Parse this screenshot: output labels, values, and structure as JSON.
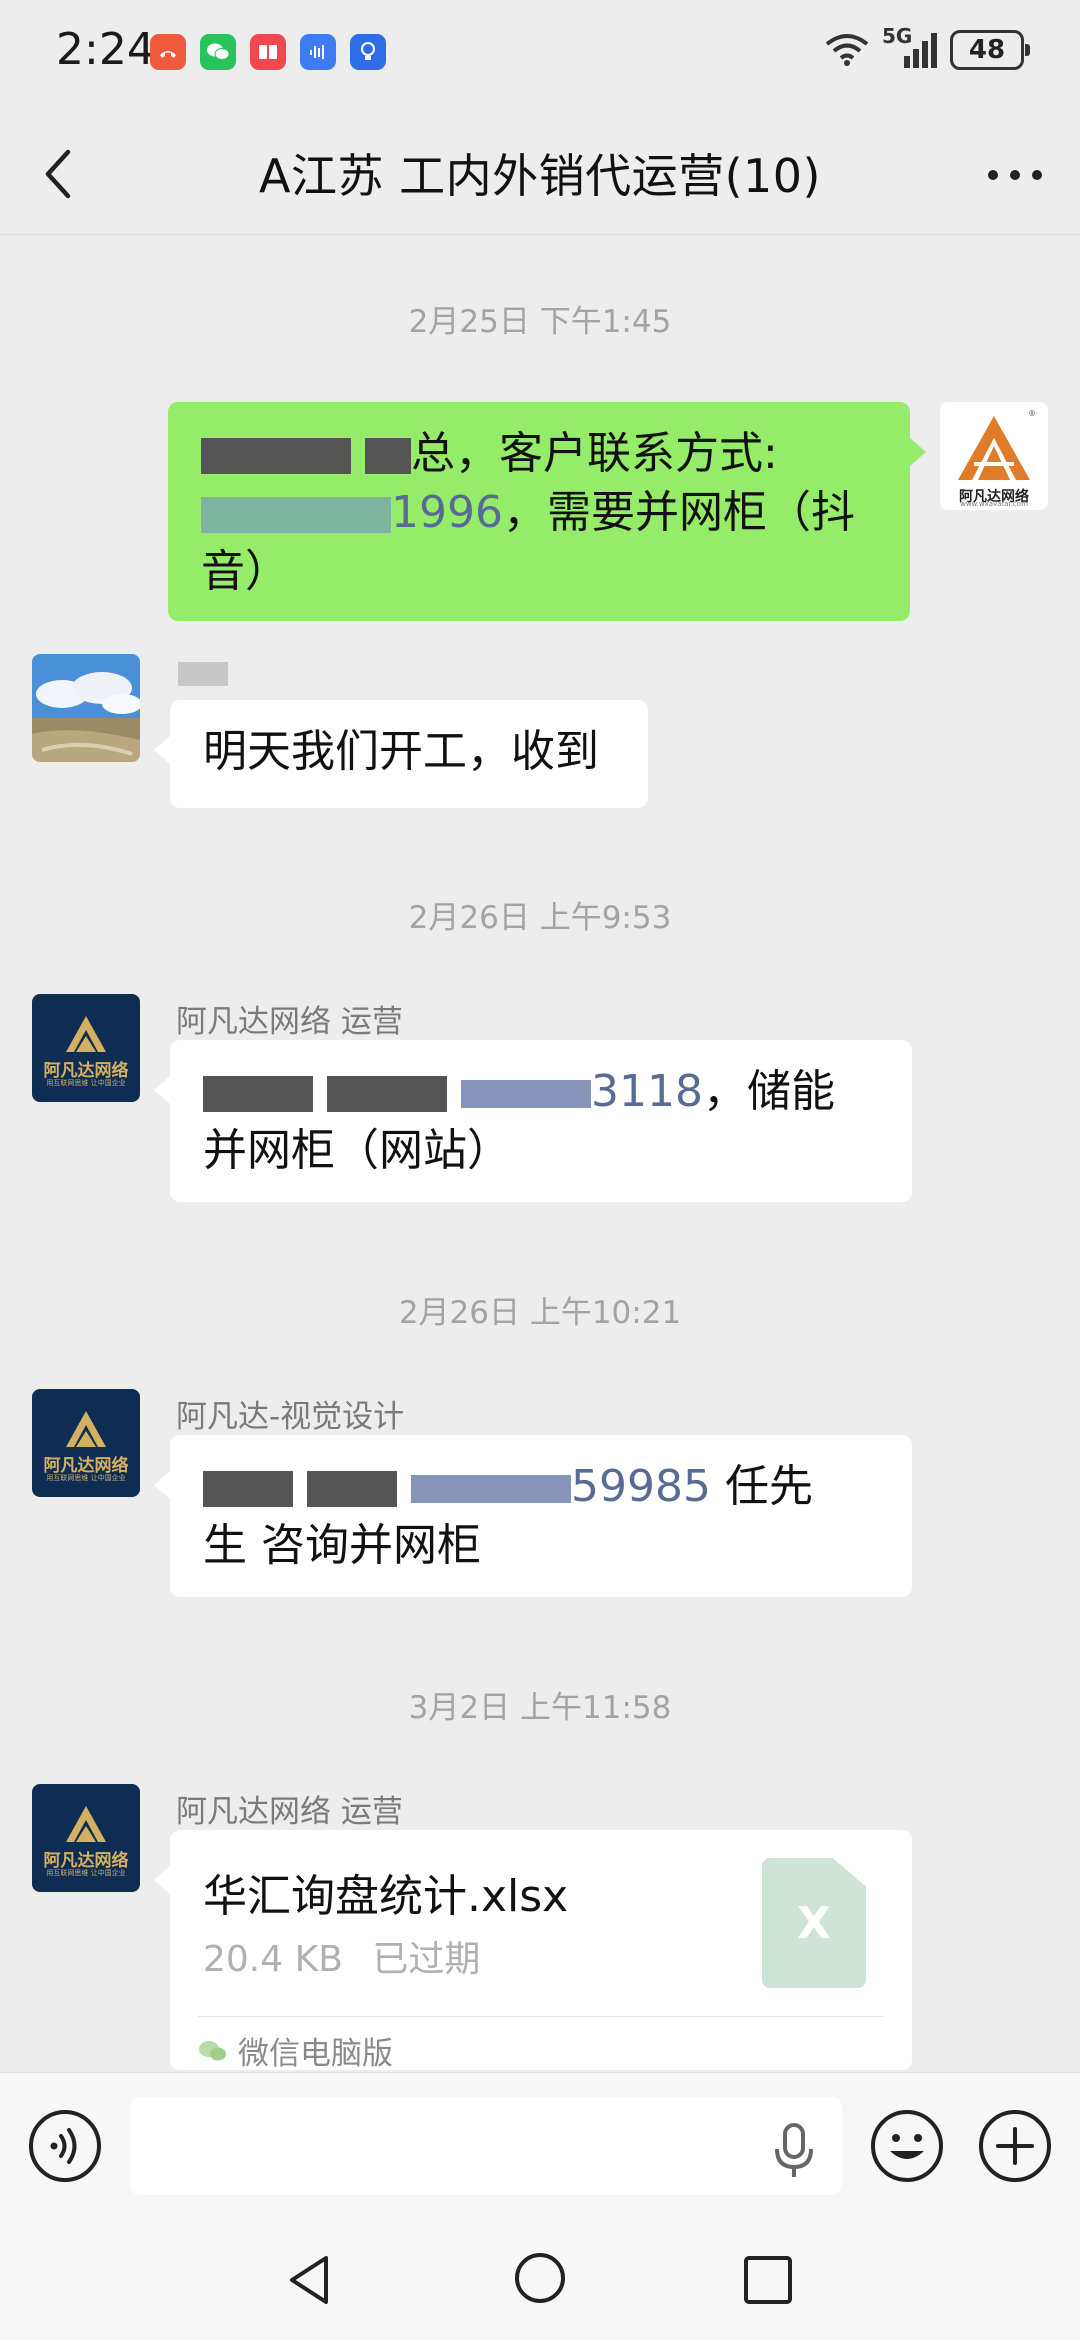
{
  "status_bar": {
    "time": "2:24",
    "network": "5G",
    "battery": "48",
    "notification_icons": [
      "missed-call-icon",
      "wechat-icon",
      "reader-icon",
      "audio-icon",
      "bulb-icon"
    ]
  },
  "header": {
    "title": "A江苏  工内外销代运营(10)"
  },
  "messages": [
    {
      "timestamp": "2月25日 下午1:45",
      "text_line1": "总，客户联系方式:",
      "phone_tail": "1996",
      "text_line2_rest": "，需要并网柜（抖",
      "text_line3": "音）"
    },
    {
      "text": "明天我们开工，收到"
    },
    {
      "timestamp": "2月26日 上午9:53",
      "sender": "阿凡达网络 运营",
      "phone_tail": "3118",
      "text_line1_rest": "，储能",
      "text_line2": "并网柜（网站）"
    },
    {
      "timestamp": "2月26日 上午10:21",
      "sender": "阿凡达-视觉设计",
      "phone_tail": "59985",
      "text_line1_rest": " 任先",
      "text_line2": "生  咨询并网柜"
    },
    {
      "timestamp": "3月2日 上午11:58",
      "sender": "阿凡达网络 运营",
      "file_name": "华汇询盘统计.xlsx",
      "file_size": "20.4 KB",
      "file_status": "已过期",
      "file_icon_letter": "X",
      "file_source": "微信电脑版"
    }
  ],
  "avatars": {
    "self_logo_text": "阿凡达网络",
    "self_logo_url_text": "www.wxavatar.com",
    "company_logo_text": "阿凡达网络",
    "company_logo_slogan": "用互联网思维  让中国企业"
  },
  "input_bar": {
    "placeholder": ""
  },
  "colors": {
    "background": "#ededed",
    "self_bubble": "#95ec69",
    "other_bubble": "#ffffff",
    "link": "#576b95",
    "timestamp": "#a3a3a3",
    "company_avatar": "#0f2d52",
    "logo_orange": "#e07b2a"
  }
}
